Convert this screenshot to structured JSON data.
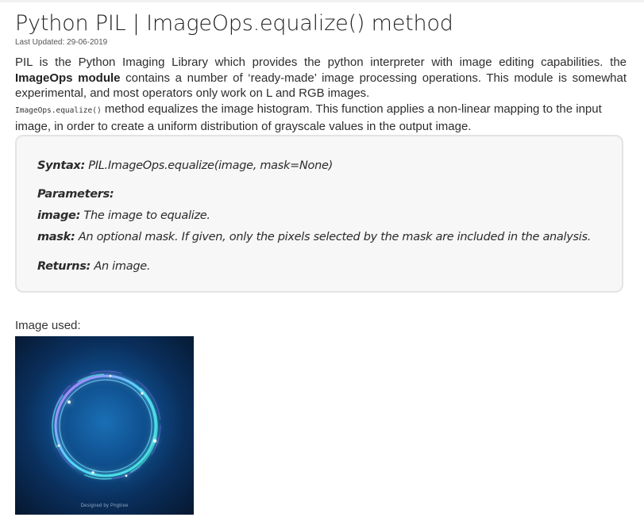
{
  "article": {
    "title": "Python PIL | ImageOps.equalize() method",
    "last_updated": "Last Updated: 29-06-2019",
    "intro": {
      "part1": "PIL is the Python Imaging Library which provides the python interpreter with image editing capabilities. the ",
      "bold": "ImageOps module",
      "part2": " contains a number of ‘ready-made’ image processing operations. This module is somewhat experimental, and most operators only work on L and RGB images."
    },
    "description": {
      "code": "ImageOps.equalize()",
      "text": " method equalizes the image histogram. This function applies a non-linear mapping to the input image, in order to create a uniform distribution of grayscale values in the output image."
    }
  },
  "syntax_box": {
    "syntax_label": "Syntax:",
    "syntax_value": " PIL.ImageOps.equalize(image, mask=None)",
    "parameters_label": "Parameters:",
    "param_image_label": "image:",
    "param_image_desc": " The image to equalize.",
    "param_mask_label": "mask:",
    "param_mask_desc": " An optional mask. If given, only the pixels selected by the mask are included in the analysis.",
    "returns_label": "Returns:",
    "returns_value": " An image."
  },
  "image_section": {
    "label": "Image used:",
    "watermark": "Designed by Pngtree",
    "image_icon": "glowing-ring-image"
  },
  "colors": {
    "text": "#2d2d2d",
    "box_bg": "#f7f7f7",
    "box_border": "#e3e3e3"
  }
}
